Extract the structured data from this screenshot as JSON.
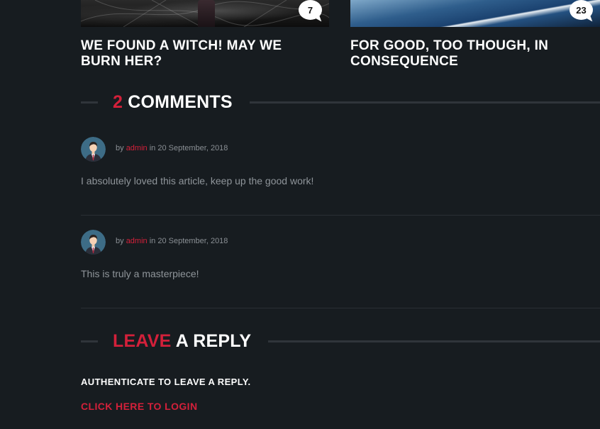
{
  "related_posts": [
    {
      "title": "WE FOUND A WITCH! MAY WE BURN HER?",
      "comment_count": "7"
    },
    {
      "title": "FOR GOOD, TOO THOUGH, IN CONSEQUENCE",
      "comment_count": "23"
    }
  ],
  "comments_section": {
    "count": "2",
    "label": "COMMENTS"
  },
  "comments": [
    {
      "by": "by",
      "author": "admin",
      "in": "in",
      "date": "20 September, 2018",
      "text": "I absolutely loved this article, keep up the good work!"
    },
    {
      "by": "by",
      "author": "admin",
      "in": "in",
      "date": "20 September, 2018",
      "text": "This is truly a masterpiece!"
    }
  ],
  "reply_section": {
    "accent": "LEAVE",
    "rest": "A REPLY",
    "auth_message": "AUTHENTICATE TO LEAVE A REPLY.",
    "login_link": "CLICK HERE TO LOGIN"
  },
  "colors": {
    "background": "#171c20",
    "accent": "#d3203a",
    "heading": "#ffffff",
    "body_text": "#8f959a"
  }
}
